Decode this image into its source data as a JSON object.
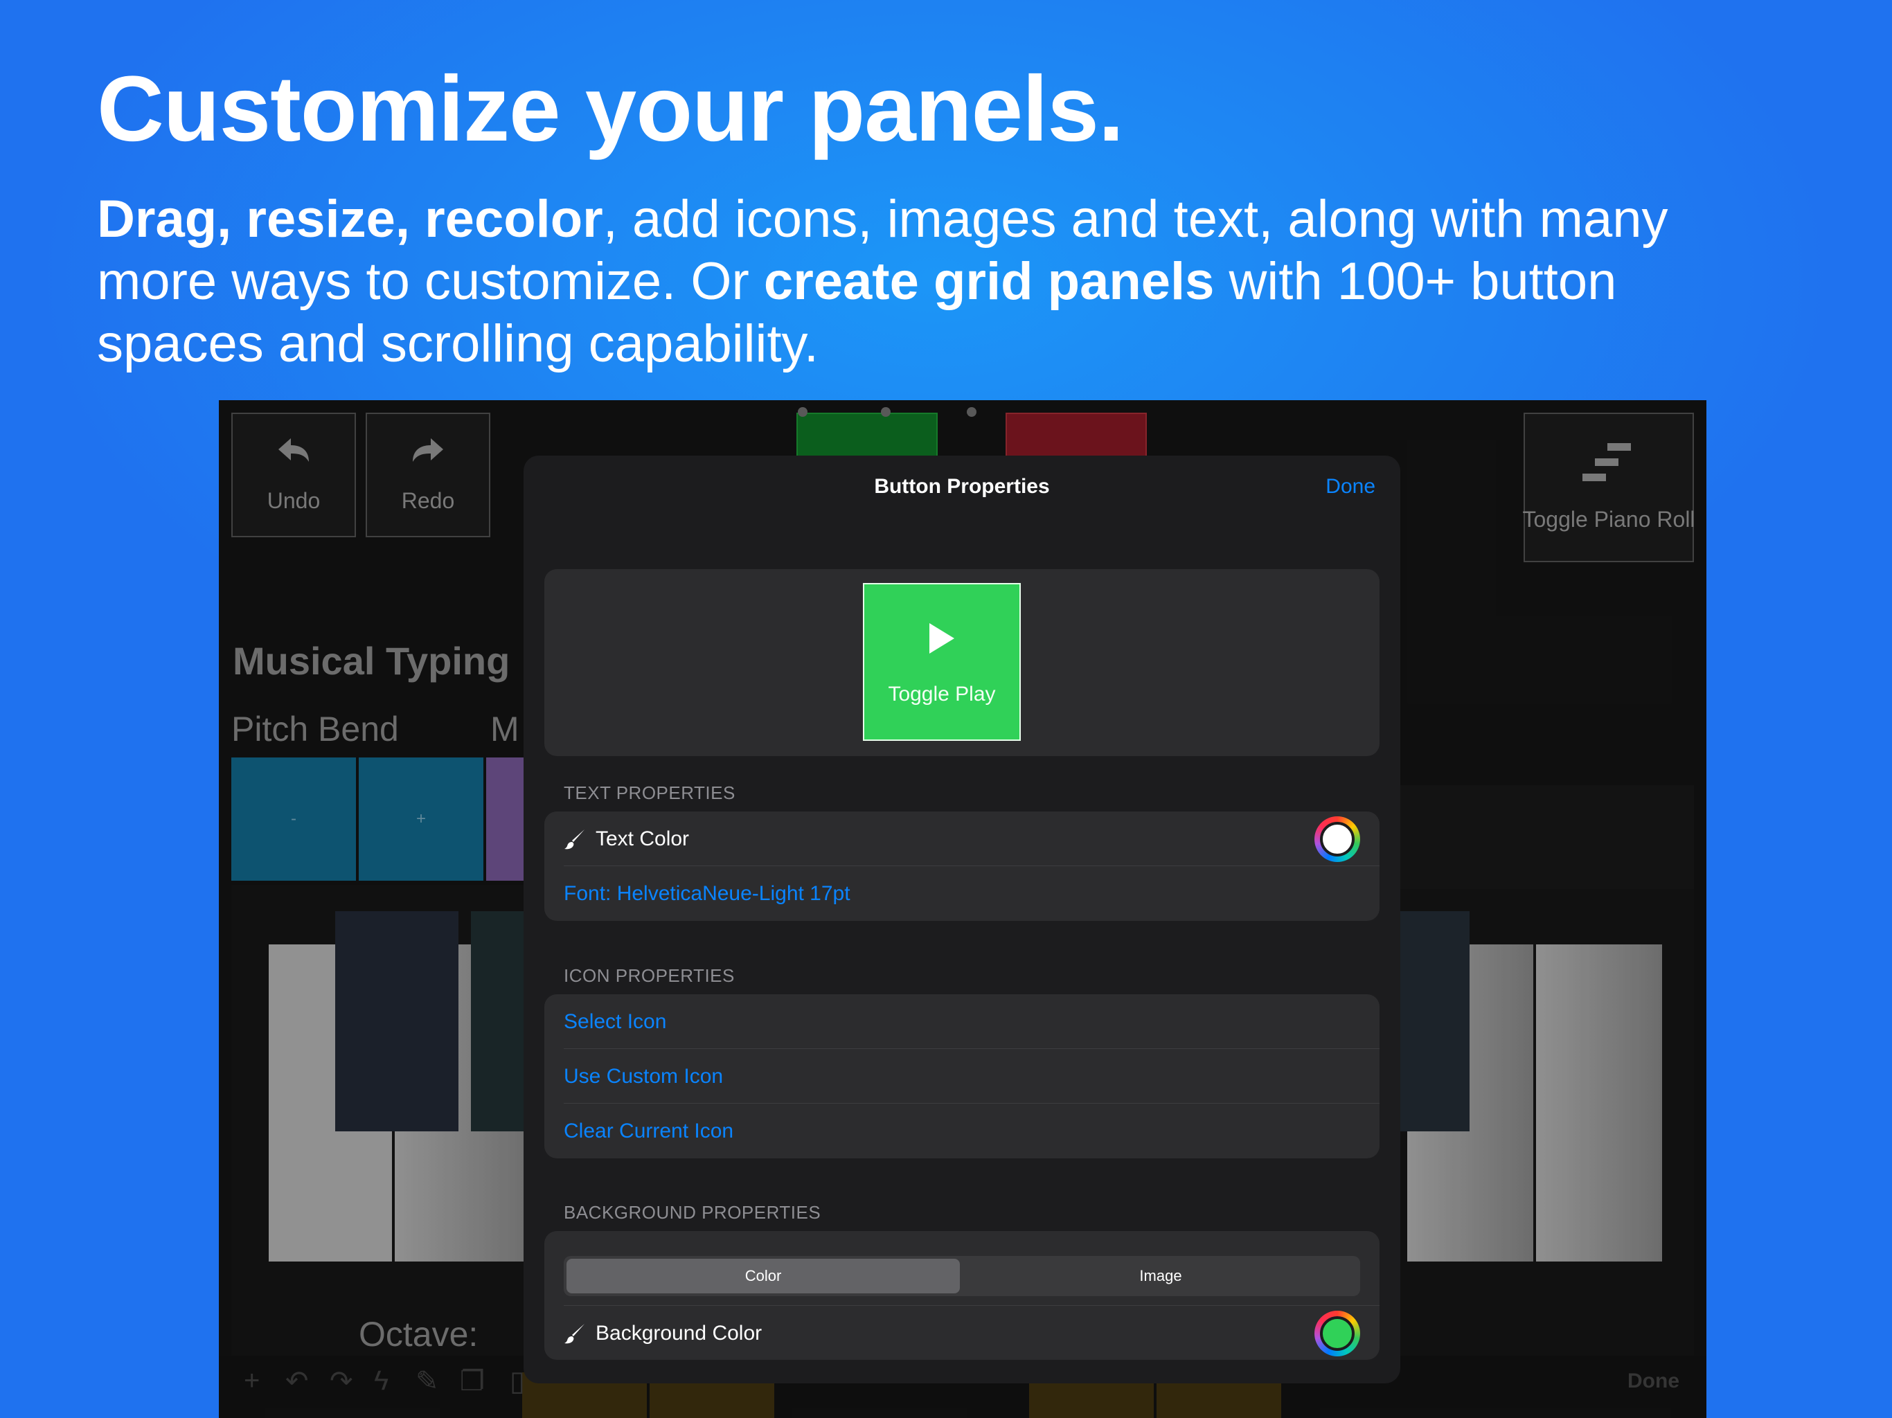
{
  "marketing": {
    "headline": "Customize your panels.",
    "sub_bold_1": "Drag, resize, recolor",
    "sub_text_1": ", add icons, images and text, along with many more ways to customize. Or ",
    "sub_bold_2": "create grid panels",
    "sub_text_2": " with 100+ button spaces and scrolling capability."
  },
  "panel": {
    "undo_label": "Undo",
    "redo_label": "Redo",
    "toggle_piano_roll_label": "Toggle Piano Roll",
    "section_title": "Musical Typing",
    "pitch_bend_label": "Pitch Bend",
    "mod_label_partial": "M",
    "pitch_minus": "-",
    "pitch_plus": "+",
    "octave_label": "Octave:",
    "toolbar_done": "Done"
  },
  "modal": {
    "title": "Button Properties",
    "done_label": "Done",
    "preview_button_label": "Toggle Play",
    "text_properties_header": "TEXT PROPERTIES",
    "text_color_label": "Text Color",
    "text_color_value": "#ffffff",
    "font_label": "Font: HelveticaNeue-Light 17pt",
    "icon_properties_header": "ICON PROPERTIES",
    "select_icon_label": "Select Icon",
    "use_custom_icon_label": "Use Custom Icon",
    "clear_current_icon_label": "Clear Current Icon",
    "background_properties_header": "BACKGROUND PROPERTIES",
    "segment_color_label": "Color",
    "segment_image_label": "Image",
    "segment_selected": "Color",
    "background_color_label": "Background Color",
    "background_color_value": "#30d158"
  },
  "colors": {
    "accent": "#0a84ff",
    "page_background": "#1e80f2",
    "button_green": "#30d158",
    "button_red": "#7a1620",
    "pitch_bend_blue": "#0f5f80",
    "mod_purple": "#6a4f8a"
  },
  "icons": [
    "undo-arrow-icon",
    "redo-arrow-icon",
    "piano-roll-steps-icon",
    "play-icon",
    "paintbrush-icon",
    "plus-icon",
    "bolt-icon",
    "copy-icon",
    "trash-icon"
  ]
}
